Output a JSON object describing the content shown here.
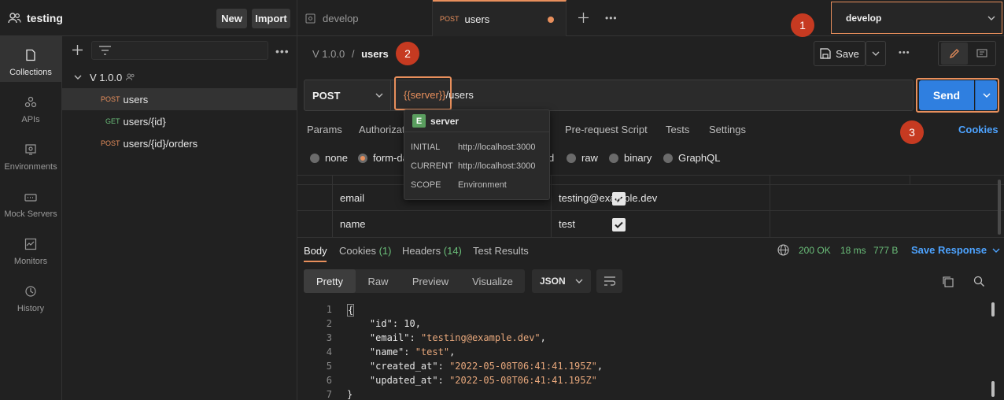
{
  "workspace": {
    "name": "testing",
    "new_label": "New",
    "import_label": "Import"
  },
  "nav": [
    {
      "label": "Collections",
      "icon": "collections-icon"
    },
    {
      "label": "APIs",
      "icon": "apis-icon"
    },
    {
      "label": "Environments",
      "icon": "environments-icon"
    },
    {
      "label": "Mock Servers",
      "icon": "mock-servers-icon"
    },
    {
      "label": "Monitors",
      "icon": "monitors-icon"
    },
    {
      "label": "History",
      "icon": "history-icon"
    }
  ],
  "sidebar": {
    "collection": "V 1.0.0",
    "items": [
      {
        "method": "POST",
        "path": "users"
      },
      {
        "method": "GET",
        "path": "users/{id}"
      },
      {
        "method": "POST",
        "path": "users/{id}/orders"
      }
    ]
  },
  "tabs": [
    {
      "label": "develop"
    },
    {
      "method": "POST",
      "label": "users"
    }
  ],
  "environment": {
    "selected": "develop"
  },
  "badges": {
    "one": "1",
    "two": "2",
    "three": "3"
  },
  "request": {
    "crumb_version": "V 1.0.0",
    "crumb_sep": "/",
    "crumb_name": "users",
    "save_label": "Save",
    "method": "POST",
    "url_var": "{{server}}",
    "url_rest": "/users",
    "send_label": "Send",
    "subtabs": [
      "Params",
      "Authorizati",
      "Pre-request Script",
      "Tests",
      "Settings"
    ],
    "cookies_label": "Cookies",
    "body_types": [
      "none",
      "form-da",
      "d",
      "raw",
      "binary",
      "GraphQL"
    ],
    "rows": [
      {
        "key": "email",
        "value": "testing@example.dev"
      },
      {
        "key": "name",
        "value": "test"
      }
    ]
  },
  "popup": {
    "badge": "E",
    "name": "server",
    "initial_label": "INITIAL",
    "initial_value": "http://localhost:3000",
    "current_label": "CURRENT",
    "current_value": "http://localhost:3000",
    "scope_label": "SCOPE",
    "scope_value": "Environment"
  },
  "response": {
    "tabs": {
      "body": "Body",
      "cookies": "Cookies",
      "cookies_count": "(1)",
      "headers": "Headers",
      "headers_count": "(14)",
      "tests": "Test Results"
    },
    "status": "200 OK",
    "time": "18 ms",
    "size": "777 B",
    "save_response": "Save Response",
    "formats": [
      "Pretty",
      "Raw",
      "Preview",
      "Visualize"
    ],
    "lang": "JSON",
    "lines": [
      {
        "n": "1",
        "text": "{"
      },
      {
        "n": "2",
        "key": "\"id\"",
        "val": " 10,"
      },
      {
        "n": "3",
        "key": "\"email\"",
        "sval": "\"testing@example.dev\"",
        "tail": ","
      },
      {
        "n": "4",
        "key": "\"name\"",
        "sval": "\"test\"",
        "tail": ","
      },
      {
        "n": "5",
        "key": "\"created_at\"",
        "sval": "\"2022-05-08T06:41:41.195Z\"",
        "tail": ","
      },
      {
        "n": "6",
        "key": "\"updated_at\"",
        "sval": "\"2022-05-08T06:41:41.195Z\"",
        "tail": ""
      },
      {
        "n": "7",
        "text": "}"
      }
    ]
  },
  "colors": {
    "accent": "#e88f5c",
    "send": "#2f7fe0",
    "badge": "#c63a21",
    "ok": "#6bbf7a",
    "link": "#4da3ff"
  }
}
